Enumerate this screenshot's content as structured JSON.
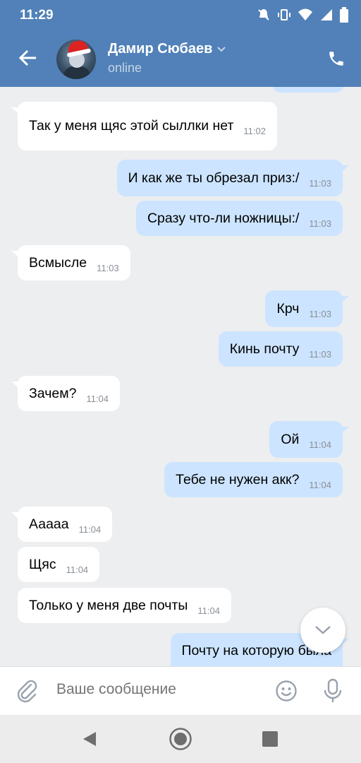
{
  "status_bar": {
    "time": "11:29"
  },
  "header": {
    "contact_name": "Дамир Сюбаев",
    "presence": "online"
  },
  "messages": [
    {
      "dir": "in",
      "text": "Так у меня щяс этой сыллки нет",
      "time": "11:02"
    },
    {
      "dir": "out",
      "text": "И как же ты обрезал приз:/",
      "time": "11:03"
    },
    {
      "dir": "out",
      "text": "Сразу что-ли ножницы:/",
      "time": "11:03"
    },
    {
      "dir": "in",
      "text": "Всмысле",
      "time": "11:03"
    },
    {
      "dir": "out",
      "text": "Крч",
      "time": "11:03"
    },
    {
      "dir": "out",
      "text": "Кинь почту",
      "time": "11:03"
    },
    {
      "dir": "in",
      "text": "Зачем?",
      "time": "11:04"
    },
    {
      "dir": "out",
      "text": "Ой",
      "time": "11:04"
    },
    {
      "dir": "out",
      "text": "Тебе не нужен акк?",
      "time": "11:04"
    },
    {
      "dir": "in",
      "text": "Ааааа",
      "time": "11:04"
    },
    {
      "dir": "in",
      "text": "Щяс",
      "time": "11:04"
    },
    {
      "dir": "in",
      "text": "Только у меня две почты",
      "time": "11:04"
    },
    {
      "dir": "out",
      "text": "Почту на которую была",
      "time": ""
    }
  ],
  "composer": {
    "placeholder": "Ваше сообщение"
  },
  "icons": {
    "back": "arrow-left-icon",
    "call": "phone-icon",
    "attach": "paperclip-icon",
    "emoji": "smile-icon",
    "voice": "microphone-icon",
    "scroll": "chevron-down-icon"
  },
  "colors": {
    "header": "#5181b8",
    "incoming": "#ffffff",
    "outgoing": "#cce4ff",
    "background": "#edeef0"
  }
}
